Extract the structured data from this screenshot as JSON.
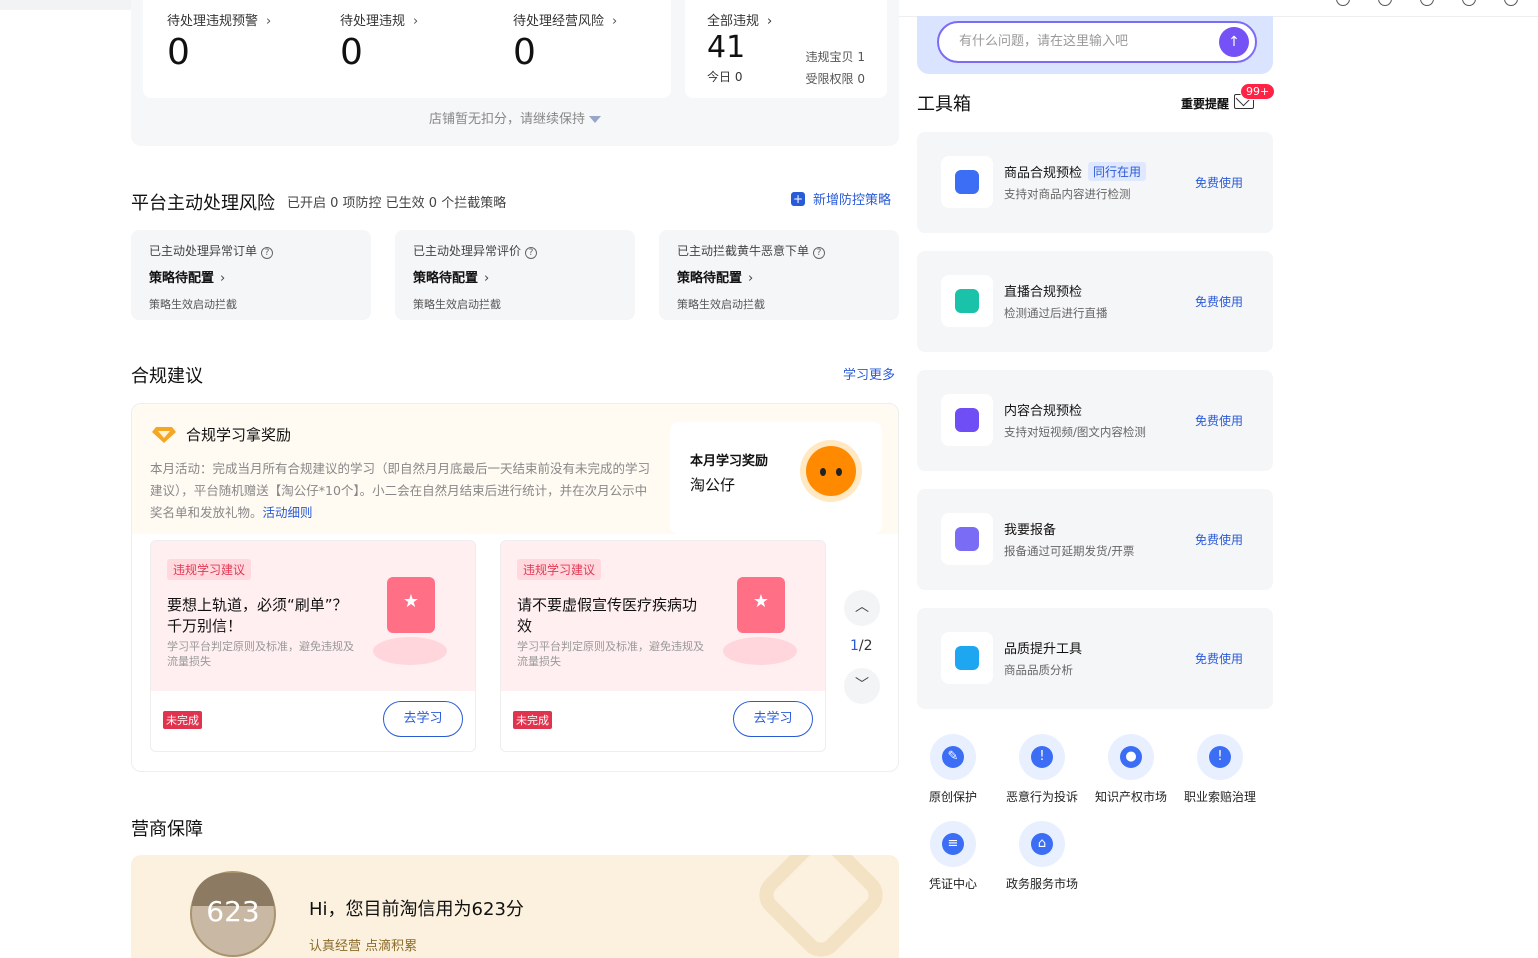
{
  "stats": {
    "items": [
      {
        "label": "待处理违规预警",
        "value": "0"
      },
      {
        "label": "待处理违规",
        "value": "0"
      },
      {
        "label": "待处理经营风险",
        "value": "0"
      }
    ],
    "total": {
      "label": "全部违规",
      "value": "41",
      "today": "今日 0",
      "goods": "违规宝贝 1",
      "perm": "受限权限 0"
    },
    "footer": "店铺暂无扣分，请继续保持"
  },
  "risk": {
    "title": "平台主动处理风险",
    "subtitle": "已开启 0 项防控 已生效 0 个拦截策略",
    "add_label": "新增防控策略",
    "cards": [
      {
        "title": "已主动处理异常订单",
        "main": "策略待配置",
        "bottom": "策略生效启动拦截"
      },
      {
        "title": "已主动处理异常评价",
        "main": "策略待配置",
        "bottom": "策略生效启动拦截"
      },
      {
        "title": "已主动拦截黄牛恶意下单",
        "main": "策略待配置",
        "bottom": "策略生效启动拦截"
      }
    ]
  },
  "compliance": {
    "title": "合规建议",
    "more": "学习更多",
    "reward_title": "合规学习拿奖励",
    "desc": "本月活动：完成当月所有合规建议的学习（即自然月月底最后一天结束前没有未完成的学习建议），平台随机赠送【淘公仔*10个】。小二会在自然月结束后进行统计，并在次月公示中奖名单和发放礼物。",
    "desc_link": "活动细则",
    "reward_card_title": "本月学习奖励",
    "reward_card_item": "淘公仔",
    "suggestions": [
      {
        "tag": "违规学习建议",
        "title": "要想上轨道，必须“刷单”？千万别信！",
        "desc": "学习平台判定原则及标准，避免违规及流量损失",
        "status": "未完成",
        "button": "去学习"
      },
      {
        "tag": "违规学习建议",
        "title": "请不要虚假宣传医疗疾病功效",
        "desc": "学习平台判定原则及标准，避免违规及流量损失",
        "status": "未完成",
        "button": "去学习"
      }
    ],
    "pager_current": "1",
    "pager_total": "/2"
  },
  "credit": {
    "title": "营商保障",
    "score": "623",
    "hi": "Hi，您目前淘信用为623分",
    "sub": "认真经营 点滴积累"
  },
  "ask": {
    "placeholder": "有什么问题，请在这里输入吧"
  },
  "toolbox": {
    "title": "工具箱",
    "notice": "重要提醒",
    "badge": "99+",
    "tools": [
      {
        "name": "商品合规预检",
        "tag": "同行在用",
        "desc": "支持对商品内容进行检测",
        "free": "免费使用",
        "color": "#3b6ef5"
      },
      {
        "name": "直播合规预检",
        "tag": "",
        "desc": "检测通过后进行直播",
        "free": "免费使用",
        "color": "#19c2a8"
      },
      {
        "name": "内容合规预检",
        "tag": "",
        "desc": "支持对短视频/图文内容检测",
        "free": "免费使用",
        "color": "#6f4ef5"
      },
      {
        "name": "我要报备",
        "tag": "",
        "desc": "报备通过可延期发货/开票",
        "free": "免费使用",
        "color": "#7b6cf5"
      },
      {
        "name": "品质提升工具",
        "tag": "",
        "desc": "商品品质分析",
        "free": "免费使用",
        "color": "#1ea6f0"
      }
    ],
    "quick": [
      {
        "label": "原创保护"
      },
      {
        "label": "恶意行为投诉"
      },
      {
        "label": "知识产权市场"
      },
      {
        "label": "职业索赔治理"
      },
      {
        "label": "凭证中心"
      },
      {
        "label": "政务服务市场"
      }
    ]
  }
}
